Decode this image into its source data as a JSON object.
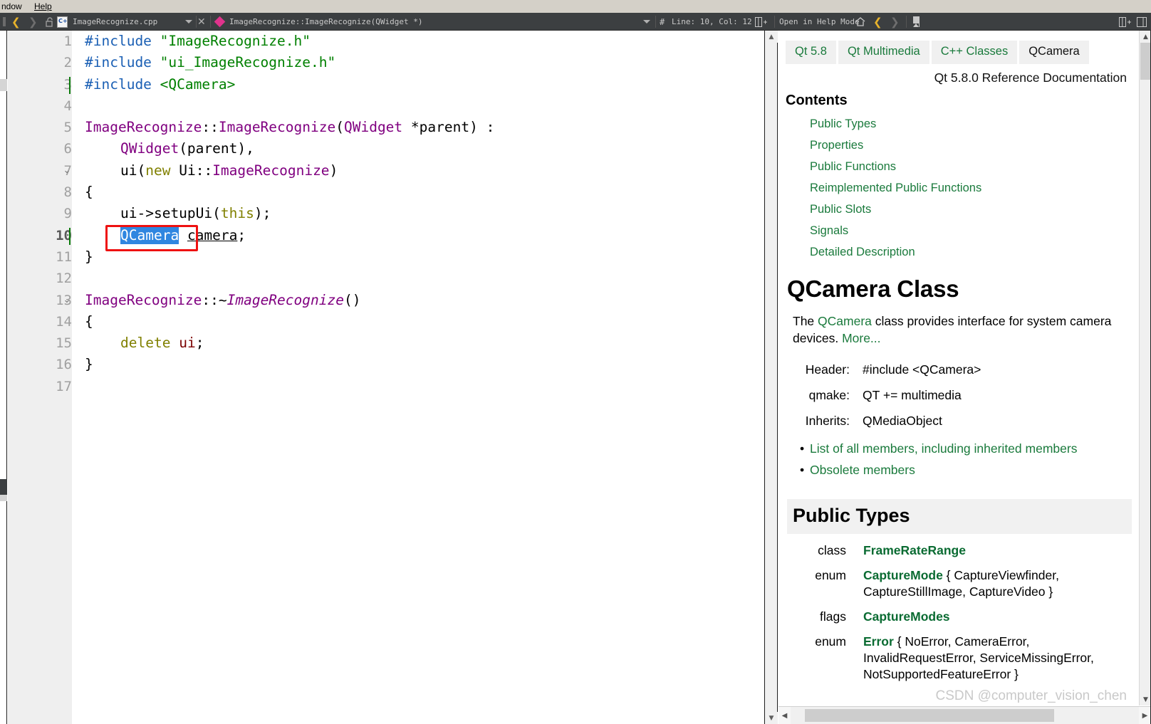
{
  "menubar": {
    "window": "ndow",
    "help": "Help"
  },
  "toolbar": {
    "back_icon": "chevron-left-icon",
    "forward_icon": "chevron-right-icon",
    "lock_icon": "unlocked-padlock-icon",
    "file_icon": "cpp-file-icon",
    "file_name": "ImageRecognize.cpp",
    "file_dropdown_icon": "chevron-down-icon",
    "close_icon": "close-icon",
    "symbol_icon": "method-diamond-icon",
    "symbol_name": "ImageRecognize::ImageRecognize(QWidget *)",
    "symbol_dropdown_icon": "chevron-down-icon",
    "line_col_icon": "hash-icon",
    "line_col": "Line: 10, Col: 12",
    "split_icon": "split-editor-icon",
    "help_mode_label": "Open in Help Mode",
    "home_icon": "home-icon",
    "help_back_icon": "help-back-icon",
    "help_forward_icon": "help-forward-icon",
    "bookmark_icon": "bookmark-icon",
    "split_right_icon": "split-editor-icon",
    "close_panel_icon": "close-panel-icon"
  },
  "editor": {
    "lines": [
      {
        "n": "1",
        "fold": "",
        "current": false
      },
      {
        "n": "2",
        "fold": "",
        "current": false
      },
      {
        "n": "3",
        "fold": "",
        "current": false
      },
      {
        "n": "4",
        "fold": "",
        "current": false
      },
      {
        "n": "5",
        "fold": "",
        "current": false
      },
      {
        "n": "6",
        "fold": "",
        "current": false
      },
      {
        "n": "7",
        "fold": "⌄",
        "current": false
      },
      {
        "n": "8",
        "fold": "",
        "current": false
      },
      {
        "n": "9",
        "fold": "",
        "current": false
      },
      {
        "n": "10",
        "fold": "",
        "current": true
      },
      {
        "n": "11",
        "fold": "",
        "current": false
      },
      {
        "n": "12",
        "fold": "",
        "current": false
      },
      {
        "n": "13",
        "fold": "⌄",
        "current": false
      },
      {
        "n": "14",
        "fold": "",
        "current": false
      },
      {
        "n": "15",
        "fold": "",
        "current": false
      },
      {
        "n": "16",
        "fold": "",
        "current": false
      },
      {
        "n": "17",
        "fold": "",
        "current": false
      }
    ],
    "code": {
      "l1_include": "#include",
      "l1_str": "\"ImageRecognize.h\"",
      "l2_include": "#include",
      "l2_str": "\"ui_ImageRecognize.h\"",
      "l3_include": "#include",
      "l3_str": "<QCamera>",
      "l5_a": "ImageRecognize",
      "l5_b": "::",
      "l5_c": "ImageRecognize",
      "l5_d": "(",
      "l5_e": "QWidget",
      "l5_f": " *parent) :",
      "l6_a": "QWidget",
      "l6_b": "(parent),",
      "l7_a": "ui",
      "l7_b": "(",
      "l7_c": "new",
      "l7_d": " Ui",
      "l7_e": "::",
      "l7_f": "ImageRecognize",
      "l7_g": ")",
      "l8": "{",
      "l9_a": "ui",
      "l9_b": "->setupUi(",
      "l9_c": "this",
      "l9_d": ");",
      "l10_sel": "QCamera",
      "l10_rest_a": " ",
      "l10_rest_b": "camera",
      "l10_rest_c": ";",
      "l11": "}",
      "l13_a": "ImageRecognize",
      "l13_b": "::~",
      "l13_c": "ImageRecognize",
      "l13_d": "()",
      "l14": "{",
      "l15_a": "delete",
      "l15_b": " ",
      "l15_c": "ui",
      "l15_d": ";",
      "l16": "}"
    },
    "annotation": {
      "name": "red-highlight-box"
    }
  },
  "help": {
    "breadcrumbs": [
      "Qt 5.8",
      "Qt Multimedia",
      "C++ Classes",
      "QCamera"
    ],
    "reference_line": "Qt 5.8.0 Reference Documentation",
    "contents_heading": "Contents",
    "toc": [
      "Public Types",
      "Properties",
      "Public Functions",
      "Reimplemented Public Functions",
      "Public Slots",
      "Signals",
      "Detailed Description"
    ],
    "class_title": "QCamera Class",
    "intro_pre": "The ",
    "intro_link": "QCamera",
    "intro_post": " class provides interface for system camera devices. ",
    "intro_more": "More...",
    "meta": [
      {
        "key": "Header:",
        "value": "#include <QCamera>",
        "link": false
      },
      {
        "key": "qmake:",
        "value": "QT += multimedia",
        "link": false
      },
      {
        "key": "Inherits:",
        "value": "QMediaObject",
        "link": true
      }
    ],
    "bullets": [
      "List of all members, including inherited members",
      "Obsolete members"
    ],
    "section_public_types": "Public Types",
    "types": [
      {
        "kind": "class",
        "name": "FrameRateRange",
        "rest": ""
      },
      {
        "kind": "enum",
        "name": "CaptureMode",
        "rest": " { CaptureViewfinder, CaptureStillImage, CaptureVideo }"
      },
      {
        "kind": "flags",
        "name": "CaptureModes",
        "rest": ""
      },
      {
        "kind": "enum",
        "name": "Error",
        "rest": " { NoError, CameraError, InvalidRequestError, ServiceMissingError, NotSupportedFeatureError }"
      }
    ],
    "scroll_up_icon": "scroll-up-arrow-icon",
    "scroll_down_icon": "scroll-down-arrow-icon",
    "scroll_left_icon": "scroll-left-arrow-icon",
    "scroll_right_icon": "scroll-right-arrow-icon"
  },
  "watermark": "CSDN @computer_vision_chen",
  "colors": {
    "toolbar_bg": "#3c3f41",
    "menubar_bg": "#d4d0c8",
    "link_green": "#1a7a3c",
    "selection_blue": "#2f86e0",
    "annotation_red": "#ee1111",
    "gutter_bg": "#efefef"
  }
}
